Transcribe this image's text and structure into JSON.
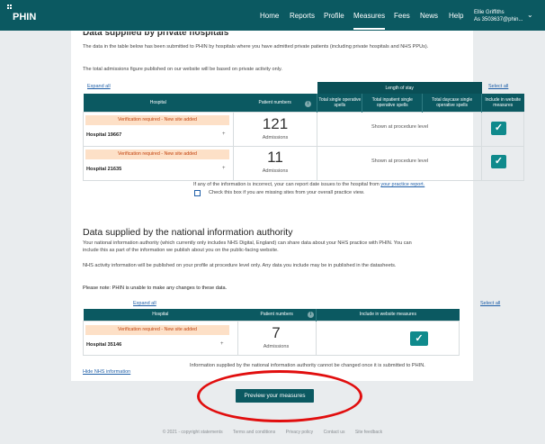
{
  "header": {
    "logo": "PHIN",
    "nav": [
      "Home",
      "Reports",
      "Profile",
      "Measures",
      "Fees",
      "News",
      "Help"
    ],
    "active": "Measures",
    "user_name": "Ellie Griffiths",
    "user_sub": "As 3503637@phin..."
  },
  "private": {
    "title_cut": "Data supplied by private hospitals",
    "intro1": "The data in the table below has been submitted to PHIN by hospitals where you have admitted private patients (including private hospitals and NHS PPUs).",
    "intro2": "The total admissions figure published on our website will be based on private activity only.",
    "expand_all": "Expand all",
    "select_all": "Select all",
    "columns": {
      "hospital": "Hospital",
      "patient_numbers": "Patient numbers",
      "length_of_stay": "Length of stay",
      "total_single": "Total single operative spells",
      "total_inpatient": "Total inpatient single operative spells",
      "total_daycase": "Total daycase single operative spells",
      "include": "Include in website measures"
    },
    "rows": [
      {
        "verify": "Verification required - New site added",
        "hospital": "Hospital 19667",
        "count": "121",
        "unit": "Admissions",
        "shown": "Shown at procedure level"
      },
      {
        "verify": "Verification required - New site added",
        "hospital": "Hospital 21635",
        "count": "11",
        "unit": "Admissions",
        "shown": "Shown at procedure level"
      }
    ],
    "incorrect_text": "If any of the information is incorrect, your can report date issues to the hospital from",
    "incorrect_link": "your practice report.",
    "missing_text": "Check this box if you are missing sites from your overall practice view."
  },
  "national": {
    "title": "Data supplied by the national information authority",
    "p1": "Your national information authority (which currently only includes NHS Digital, England) can share data about your NHS practice with PHIN. You can include this as part of the information we publish about you on the public-facing website.",
    "p2": "NHS activity information will be published on your profile at procedure level only. Any data you include may be in published in the datasheets.",
    "p3": "Please note: PHIN is unable to make any changes to these data.",
    "expand_all": "Expand all",
    "select_all": "Select all",
    "columns": {
      "hospital": "Hospital",
      "patient_numbers": "Patient numbers",
      "include": "Include in website measures"
    },
    "row": {
      "verify": "Verification required - New site added",
      "hospital": "Hospital 35146",
      "count": "7",
      "unit": "Admissions"
    },
    "hide_link": "Hide NHS information",
    "note": "Information supplied by the national information authority cannot be changed once it is submitted to PHIN."
  },
  "preview_button": "Preview your measures",
  "footer": [
    "© 2021 - copyright statements",
    "Terms and conditions",
    "Privacy policy",
    "Contact us",
    "Site feedback"
  ],
  "colors": {
    "brand": "#0b5961",
    "check": "#0f8a8c",
    "warning_bg": "#fde0c7",
    "warning_text": "#c2410c",
    "highlight": "#e10e0e",
    "link": "#1f5fa8"
  },
  "icons": {
    "checked": "check-icon",
    "info": "info-icon",
    "expand": "plus-icon",
    "menu": "chevron-down-icon"
  }
}
